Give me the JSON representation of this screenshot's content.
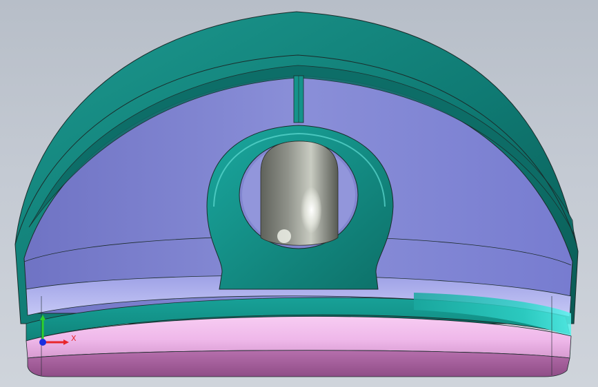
{
  "viewport": {
    "background_top": "#b7bec8",
    "background_bottom": "#cfd4db"
  },
  "model": {
    "colors": {
      "outer_shell": "#0f7a73",
      "outer_shell_light": "#1d9a90",
      "outer_shell_dark": "#0a5953",
      "inner_cavity": "#8186d0",
      "inner_cavity_light": "#b3b5ee",
      "ring_band": "#1aa89f",
      "ring_band_light": "#58f4ee",
      "base_plate": "#efb8ea",
      "base_plate_dark": "#a05d98",
      "pin": "#8f928a",
      "pin_highlight": "#f4f6ee",
      "edge_line": "#1b2b2a"
    }
  },
  "triad": {
    "x_label": "X",
    "x_color": "#e8262b",
    "y_color": "#2fd12c",
    "z_color": "#1a2ee0"
  }
}
